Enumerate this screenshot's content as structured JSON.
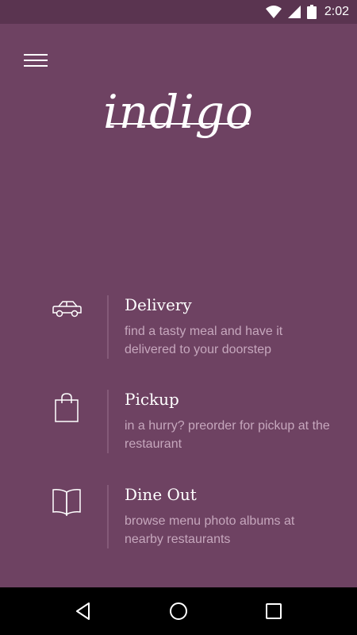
{
  "status_bar": {
    "time": "2:02",
    "icons": [
      "wifi-icon",
      "cell-signal-icon",
      "battery-icon"
    ]
  },
  "header": {
    "menu_icon": "hamburger-menu-icon",
    "logo_text": "indigo"
  },
  "options": [
    {
      "icon": "car-icon",
      "title": "Delivery",
      "description": "find a tasty meal and have it delivered to your doorstep"
    },
    {
      "icon": "shopping-bag-icon",
      "title": "Pickup",
      "description": "in a hurry? preorder for pickup at the restaurant"
    },
    {
      "icon": "book-icon",
      "title": "Dine Out",
      "description": "browse menu photo albums at nearby restaurants"
    }
  ],
  "nav_bar": {
    "buttons": [
      "back-icon",
      "home-icon",
      "recents-icon"
    ]
  },
  "colors": {
    "background": "#6e4262",
    "status_bar": "#5a3450",
    "description_text": "#c6a7bd",
    "divider": "#845a78"
  }
}
